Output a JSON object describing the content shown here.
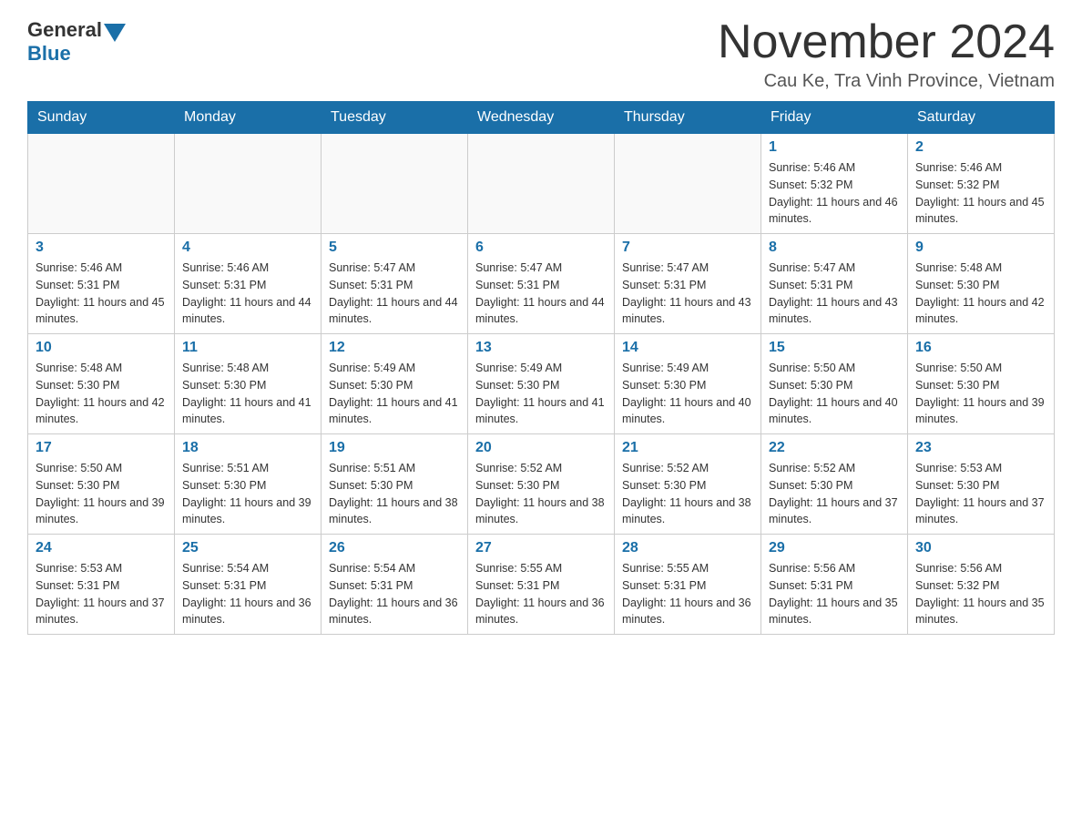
{
  "header": {
    "logo_general": "General",
    "logo_blue": "Blue",
    "month_title": "November 2024",
    "location": "Cau Ke, Tra Vinh Province, Vietnam"
  },
  "weekdays": [
    "Sunday",
    "Monday",
    "Tuesday",
    "Wednesday",
    "Thursday",
    "Friday",
    "Saturday"
  ],
  "weeks": [
    [
      {
        "day": "",
        "info": ""
      },
      {
        "day": "",
        "info": ""
      },
      {
        "day": "",
        "info": ""
      },
      {
        "day": "",
        "info": ""
      },
      {
        "day": "",
        "info": ""
      },
      {
        "day": "1",
        "info": "Sunrise: 5:46 AM\nSunset: 5:32 PM\nDaylight: 11 hours and 46 minutes."
      },
      {
        "day": "2",
        "info": "Sunrise: 5:46 AM\nSunset: 5:32 PM\nDaylight: 11 hours and 45 minutes."
      }
    ],
    [
      {
        "day": "3",
        "info": "Sunrise: 5:46 AM\nSunset: 5:31 PM\nDaylight: 11 hours and 45 minutes."
      },
      {
        "day": "4",
        "info": "Sunrise: 5:46 AM\nSunset: 5:31 PM\nDaylight: 11 hours and 44 minutes."
      },
      {
        "day": "5",
        "info": "Sunrise: 5:47 AM\nSunset: 5:31 PM\nDaylight: 11 hours and 44 minutes."
      },
      {
        "day": "6",
        "info": "Sunrise: 5:47 AM\nSunset: 5:31 PM\nDaylight: 11 hours and 44 minutes."
      },
      {
        "day": "7",
        "info": "Sunrise: 5:47 AM\nSunset: 5:31 PM\nDaylight: 11 hours and 43 minutes."
      },
      {
        "day": "8",
        "info": "Sunrise: 5:47 AM\nSunset: 5:31 PM\nDaylight: 11 hours and 43 minutes."
      },
      {
        "day": "9",
        "info": "Sunrise: 5:48 AM\nSunset: 5:30 PM\nDaylight: 11 hours and 42 minutes."
      }
    ],
    [
      {
        "day": "10",
        "info": "Sunrise: 5:48 AM\nSunset: 5:30 PM\nDaylight: 11 hours and 42 minutes."
      },
      {
        "day": "11",
        "info": "Sunrise: 5:48 AM\nSunset: 5:30 PM\nDaylight: 11 hours and 41 minutes."
      },
      {
        "day": "12",
        "info": "Sunrise: 5:49 AM\nSunset: 5:30 PM\nDaylight: 11 hours and 41 minutes."
      },
      {
        "day": "13",
        "info": "Sunrise: 5:49 AM\nSunset: 5:30 PM\nDaylight: 11 hours and 41 minutes."
      },
      {
        "day": "14",
        "info": "Sunrise: 5:49 AM\nSunset: 5:30 PM\nDaylight: 11 hours and 40 minutes."
      },
      {
        "day": "15",
        "info": "Sunrise: 5:50 AM\nSunset: 5:30 PM\nDaylight: 11 hours and 40 minutes."
      },
      {
        "day": "16",
        "info": "Sunrise: 5:50 AM\nSunset: 5:30 PM\nDaylight: 11 hours and 39 minutes."
      }
    ],
    [
      {
        "day": "17",
        "info": "Sunrise: 5:50 AM\nSunset: 5:30 PM\nDaylight: 11 hours and 39 minutes."
      },
      {
        "day": "18",
        "info": "Sunrise: 5:51 AM\nSunset: 5:30 PM\nDaylight: 11 hours and 39 minutes."
      },
      {
        "day": "19",
        "info": "Sunrise: 5:51 AM\nSunset: 5:30 PM\nDaylight: 11 hours and 38 minutes."
      },
      {
        "day": "20",
        "info": "Sunrise: 5:52 AM\nSunset: 5:30 PM\nDaylight: 11 hours and 38 minutes."
      },
      {
        "day": "21",
        "info": "Sunrise: 5:52 AM\nSunset: 5:30 PM\nDaylight: 11 hours and 38 minutes."
      },
      {
        "day": "22",
        "info": "Sunrise: 5:52 AM\nSunset: 5:30 PM\nDaylight: 11 hours and 37 minutes."
      },
      {
        "day": "23",
        "info": "Sunrise: 5:53 AM\nSunset: 5:30 PM\nDaylight: 11 hours and 37 minutes."
      }
    ],
    [
      {
        "day": "24",
        "info": "Sunrise: 5:53 AM\nSunset: 5:31 PM\nDaylight: 11 hours and 37 minutes."
      },
      {
        "day": "25",
        "info": "Sunrise: 5:54 AM\nSunset: 5:31 PM\nDaylight: 11 hours and 36 minutes."
      },
      {
        "day": "26",
        "info": "Sunrise: 5:54 AM\nSunset: 5:31 PM\nDaylight: 11 hours and 36 minutes."
      },
      {
        "day": "27",
        "info": "Sunrise: 5:55 AM\nSunset: 5:31 PM\nDaylight: 11 hours and 36 minutes."
      },
      {
        "day": "28",
        "info": "Sunrise: 5:55 AM\nSunset: 5:31 PM\nDaylight: 11 hours and 36 minutes."
      },
      {
        "day": "29",
        "info": "Sunrise: 5:56 AM\nSunset: 5:31 PM\nDaylight: 11 hours and 35 minutes."
      },
      {
        "day": "30",
        "info": "Sunrise: 5:56 AM\nSunset: 5:32 PM\nDaylight: 11 hours and 35 minutes."
      }
    ]
  ]
}
